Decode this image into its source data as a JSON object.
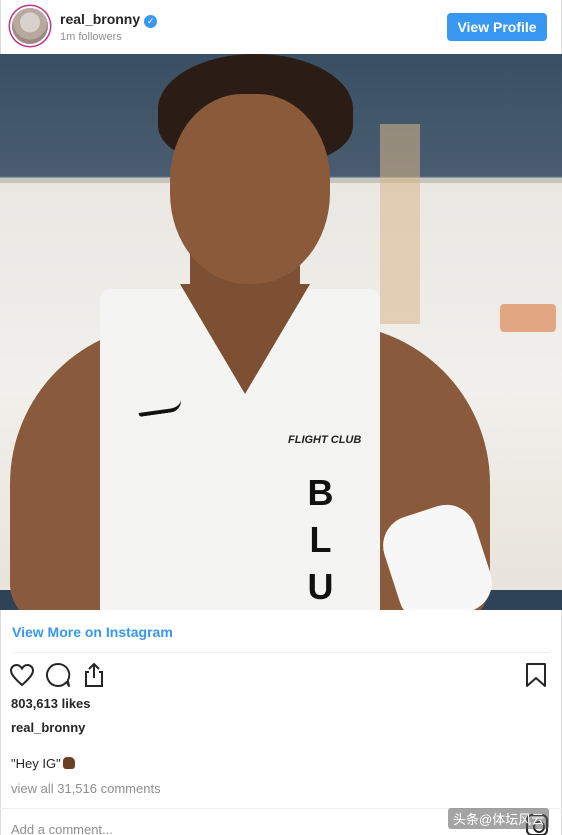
{
  "header": {
    "username": "real_bronny",
    "followers": "1m followers",
    "view_profile_label": "View Profile"
  },
  "photo": {
    "jersey_brand_text": "FLIGHT CLUB",
    "jersey_vertical_text": "BLU"
  },
  "links": {
    "view_more_label": "View More on Instagram"
  },
  "post": {
    "likes": "803,613 likes",
    "caption_username": "real_bronny",
    "caption_text": "\"Hey IG\"",
    "view_all_comments": "view all 31,516 comments",
    "add_comment_placeholder": "Add a comment..."
  },
  "watermark": {
    "text": "头条@体坛风云"
  },
  "colors": {
    "accent": "#3897f0",
    "text": "#262626",
    "muted": "#8e8e8e"
  },
  "icons": [
    "verified-badge-icon",
    "heart-icon",
    "comment-icon",
    "share-icon",
    "bookmark-icon",
    "instagram-icon"
  ]
}
